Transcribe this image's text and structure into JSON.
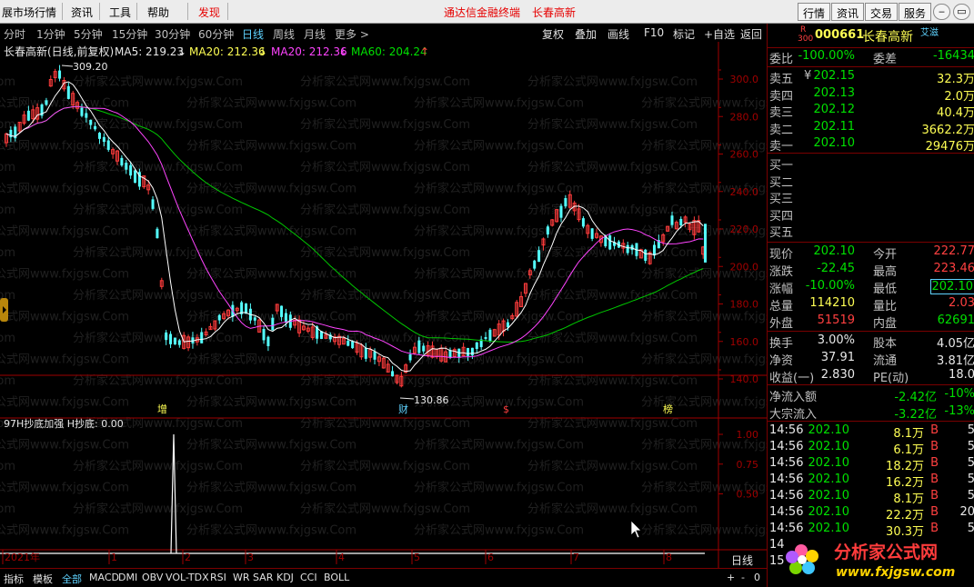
{
  "menu": {
    "items": [
      "展市场行情",
      "资讯",
      "工具",
      "帮助"
    ],
    "warn": "发现",
    "center_title": "通达信金融终端",
    "center_stock": "长春高新",
    "right_buttons": [
      "行情",
      "资讯",
      "交易",
      "服务"
    ]
  },
  "period_bar": {
    "items": [
      "分时",
      "1分钟",
      "5分钟",
      "15分钟",
      "30分钟",
      "60分钟",
      "日线",
      "周线",
      "月线",
      "更多 >"
    ],
    "active": "日线",
    "tools": [
      "复权",
      "叠加",
      "画线",
      "F10",
      "标记",
      "+自选",
      "返回"
    ]
  },
  "chart_header": {
    "title": "长春高新(日线,前复权)",
    "ma5": "MA5: 219.23",
    "ma20a": "MA20: 212.36",
    "ma20b": "MA20: 212.36",
    "ma60": "MA60: 204.24",
    "high_label": "309.20",
    "low_label": "130.86",
    "event_markers": [
      "增",
      "财",
      "$",
      "榜"
    ]
  },
  "colors": {
    "up": "#ff3c3c",
    "down": "#54ffff",
    "ma5": "#ffffff",
    "ma20": "#ff44ff",
    "ma60": "#00c800",
    "axis": "#a00000"
  },
  "price_axis": {
    "ticks": [
      "300.0",
      "280.0",
      "260.0",
      "240.0",
      "220.0",
      "200.0",
      "180.0",
      "160.0",
      "140.0"
    ]
  },
  "indicator": {
    "header": "97H抄底加强 H抄底: 0.00",
    "ticks": [
      "1.00",
      "0.75",
      "0.50"
    ]
  },
  "time_axis": {
    "labels": [
      "2021年",
      "1",
      "2",
      "3",
      "4",
      "5",
      "6",
      "7",
      "8"
    ],
    "right_label": "日线",
    "controls": [
      "+",
      "-",
      "0"
    ]
  },
  "watermark": {
    "text": "分析家公式网www.fxjgsw.Com"
  },
  "quote": {
    "code": "000661",
    "name": "长春高新",
    "badge": "艾滋",
    "r_mark": "R",
    "r_num": "300",
    "weibi_label": "委比",
    "weibi_value": "-100.00%",
    "weicha_label": "委差",
    "weicha_value": "-16434",
    "asks": [
      {
        "label": "卖五",
        "price": "202.15",
        "vol": "32.3万",
        "mark": "¥"
      },
      {
        "label": "卖四",
        "price": "202.13",
        "vol": "2.0万",
        "mark": ""
      },
      {
        "label": "卖三",
        "price": "202.12",
        "vol": "40.4万",
        "mark": ""
      },
      {
        "label": "卖二",
        "price": "202.11",
        "vol": "3662.2万",
        "mark": ""
      },
      {
        "label": "卖一",
        "price": "202.10",
        "vol": "29476万",
        "mark": ""
      }
    ],
    "bids": [
      "买一",
      "买二",
      "买三",
      "买四",
      "买五"
    ],
    "stats": [
      {
        "l1": "现价",
        "v1": "202.10",
        "l2": "今开",
        "v2": "222.77"
      },
      {
        "l1": "涨跌",
        "v1": "-22.45",
        "l2": "最高",
        "v2": "223.46"
      },
      {
        "l1": "涨幅",
        "v1": "-10.00%",
        "l2": "最低",
        "v2": "202.10"
      },
      {
        "l1": "总量",
        "v1": "114210",
        "l2": "量比",
        "v2": "2.03"
      },
      {
        "l1": "外盘",
        "v1": "51519",
        "l2": "内盘",
        "v2": "62691"
      }
    ],
    "fin": [
      {
        "l1": "换手",
        "v1": "3.00%",
        "l2": "股本",
        "v2": "4.05亿"
      },
      {
        "l1": "净资",
        "v1": "37.91",
        "l2": "流通",
        "v2": "3.81亿"
      },
      {
        "l1": "收益(一)",
        "v1": "2.830",
        "l2": "PE(动)",
        "v2": "18.0"
      }
    ],
    "flows": [
      {
        "label": "净流入额",
        "value": "-2.42亿",
        "pct": "-10%"
      },
      {
        "label": "大宗流入",
        "value": "-3.22亿",
        "pct": "-13%"
      }
    ],
    "trades": [
      {
        "time": "14:56",
        "price": "202.10",
        "vol": "8.1万",
        "bs": "B",
        "n": "5"
      },
      {
        "time": "14:56",
        "price": "202.10",
        "vol": "6.1万",
        "bs": "B",
        "n": "5"
      },
      {
        "time": "14:56",
        "price": "202.10",
        "vol": "18.2万",
        "bs": "B",
        "n": "5"
      },
      {
        "time": "14:56",
        "price": "202.10",
        "vol": "16.2万",
        "bs": "B",
        "n": "5"
      },
      {
        "time": "14:56",
        "price": "202.10",
        "vol": "8.1万",
        "bs": "B",
        "n": "5"
      },
      {
        "time": "14:56",
        "price": "202.10",
        "vol": "22.2万",
        "bs": "B",
        "n": "20"
      },
      {
        "time": "14:56",
        "price": "202.10",
        "vol": "30.3万",
        "bs": "B",
        "n": "5"
      },
      {
        "time": "14",
        "price": "",
        "vol": "",
        "bs": "",
        "n": ""
      },
      {
        "time": "15",
        "price": "",
        "vol": "",
        "bs": "",
        "n": ""
      }
    ]
  },
  "bottom_tabs": {
    "items": [
      "指标",
      "模板",
      "全部",
      "MACD",
      "DMI",
      "OBV",
      "VOL-TDX",
      "RSI",
      "WR",
      "SAR",
      "KDJ",
      "CCI",
      "BOLL"
    ],
    "active": "全部"
  },
  "logo": {
    "name": "分析家公式网",
    "url": "www.fxjgsw.com"
  }
}
